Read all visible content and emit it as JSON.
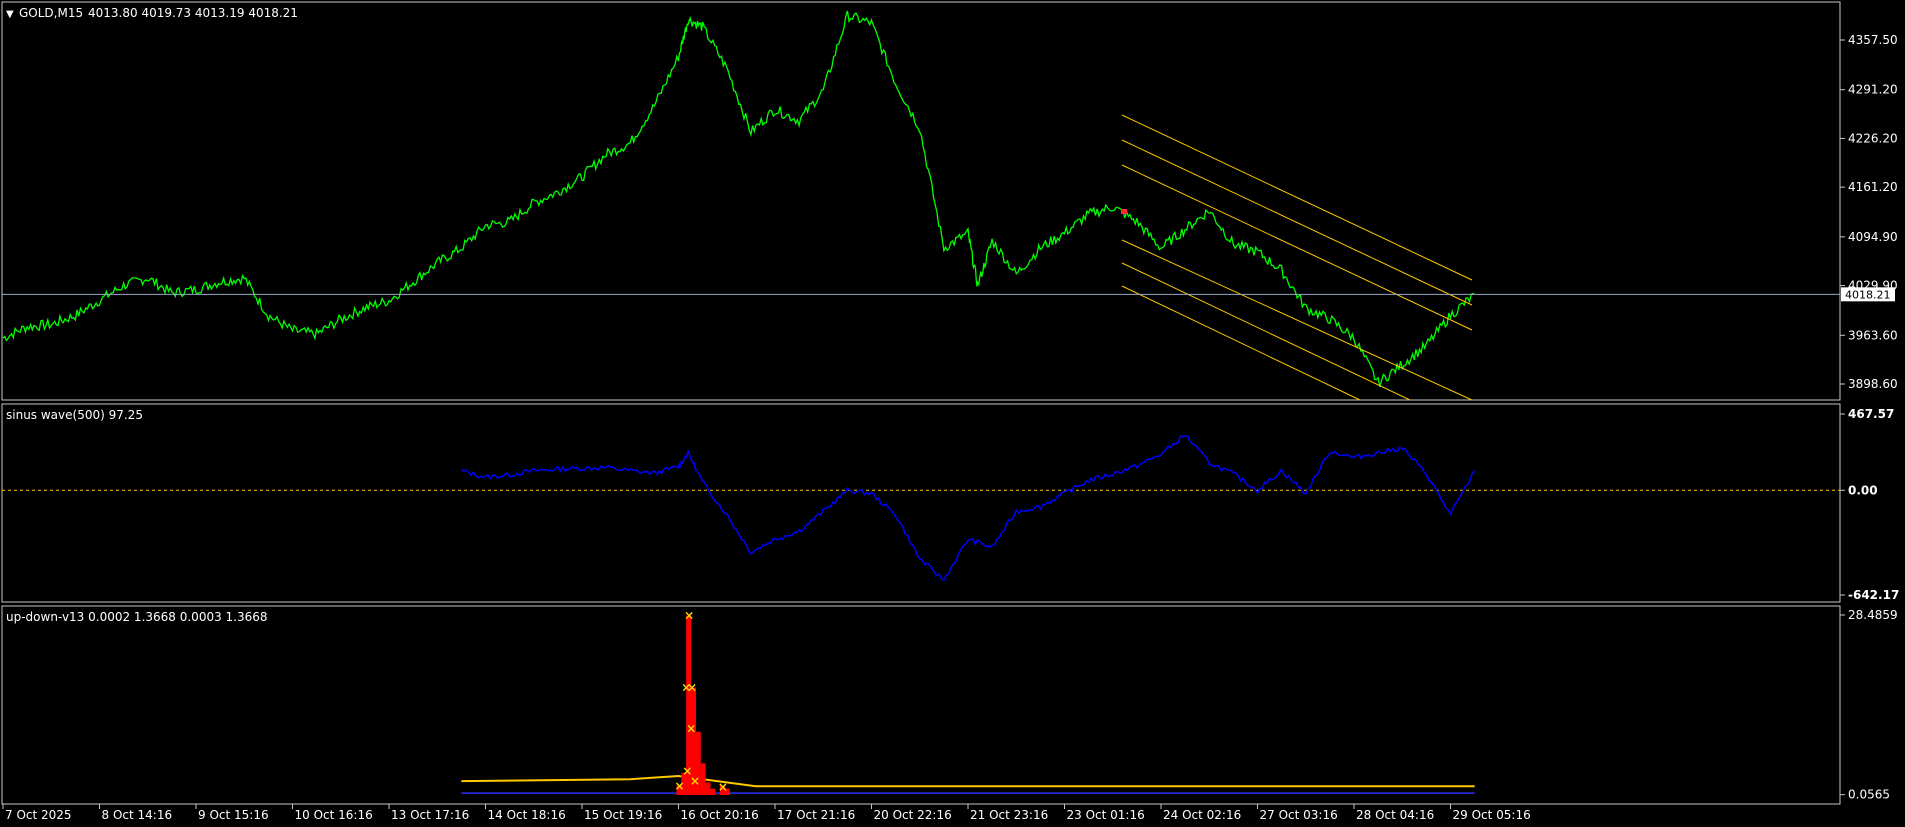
{
  "header": {
    "symbol_label": "GOLD,M15",
    "ohlc": "4013.80 4019.73 4013.19 4018.21"
  },
  "colors": {
    "background": "#000000",
    "frame": "#c8c8c8",
    "price_line": "#00ff00",
    "channel": "#ffc800",
    "sinus": "#0000ff",
    "histogram": "#ff0000",
    "marker": "#ffd700",
    "current_price_line": "#9aa8c8"
  },
  "chart_data": [
    {
      "type": "line",
      "panel": "main",
      "series_label": "GOLD,M15",
      "current_price": 4018.21,
      "current_price_label": "4018.21",
      "yticks": [
        "4357.50",
        "4291.20",
        "4226.20",
        "4161.20",
        "4094.90",
        "4029.90",
        "3963.60",
        "3898.60"
      ],
      "ylim": [
        3880,
        4410
      ],
      "x_dates": [
        "7 Oct 2025",
        "8 Oct 14:16",
        "9 Oct 15:16",
        "10 Oct 16:16",
        "13 Oct 17:16",
        "14 Oct 18:16",
        "15 Oct 19:16",
        "16 Oct 20:16",
        "17 Oct 21:16",
        "20 Oct 22:16",
        "21 Oct 23:16",
        "23 Oct 01:16",
        "24 Oct 02:16",
        "27 Oct 03:16",
        "28 Oct 04:16",
        "29 Oct 05:16"
      ],
      "x": [
        0,
        0.25,
        0.5,
        0.75,
        1,
        1.25,
        1.5,
        1.75,
        2,
        2.25,
        2.5,
        2.75,
        3,
        3.25,
        3.5,
        3.75,
        4,
        4.25,
        4.5,
        4.75,
        5,
        5.25,
        5.5,
        5.75,
        6,
        6.25,
        6.5,
        6.75,
        7,
        7.1,
        7.25,
        7.5,
        7.75,
        8,
        8.25,
        8.5,
        8.75,
        9,
        9.25,
        9.5,
        9.75,
        10,
        10.1,
        10.25,
        10.5,
        10.75,
        11,
        11.25,
        11.5,
        11.75,
        12,
        12.25,
        12.5,
        12.75,
        13,
        13.25,
        13.5,
        13.75,
        14,
        14.25,
        14.5,
        14.75,
        15,
        15.25
      ],
      "values": [
        3960,
        3975,
        3978,
        3990,
        4010,
        4030,
        4040,
        4020,
        4025,
        4035,
        4040,
        3990,
        3970,
        3965,
        3985,
        4000,
        4010,
        4035,
        4060,
        4080,
        4110,
        4115,
        4140,
        4155,
        4175,
        4205,
        4220,
        4270,
        4335,
        4385,
        4375,
        4320,
        4235,
        4265,
        4250,
        4290,
        4390,
        4380,
        4300,
        4240,
        4080,
        4100,
        4030,
        4090,
        4045,
        4080,
        4100,
        4125,
        4135,
        4115,
        4080,
        4105,
        4130,
        4085,
        4075,
        4050,
        4000,
        3985,
        3960,
        3900,
        3925,
        3950,
        3990,
        4018
      ]
    },
    {
      "type": "line",
      "panel": "indicator",
      "series_label": "sinus wave(500) 97.25",
      "yticks": [
        "467.57",
        "0.00",
        "-642.17"
      ],
      "ylim": [
        -642.17,
        467.57
      ],
      "x": [
        4.75,
        5,
        5.25,
        5.5,
        5.75,
        6,
        6.25,
        6.5,
        6.75,
        7,
        7.1,
        7.25,
        7.5,
        7.75,
        8,
        8.25,
        8.5,
        8.75,
        9,
        9.25,
        9.5,
        9.75,
        10,
        10.25,
        10.5,
        10.75,
        11,
        11.25,
        11.5,
        11.75,
        12,
        12.25,
        12.5,
        12.75,
        13,
        13.25,
        13.5,
        13.75,
        14,
        14.25,
        14.5,
        14.75,
        15,
        15.25
      ],
      "values": [
        120,
        80,
        95,
        120,
        130,
        135,
        140,
        120,
        105,
        145,
        230,
        50,
        -150,
        -380,
        -300,
        -250,
        -130,
        0,
        -20,
        -150,
        -420,
        -550,
        -300,
        -350,
        -130,
        -100,
        -20,
        60,
        100,
        150,
        220,
        340,
        170,
        100,
        0,
        120,
        -20,
        240,
        200,
        230,
        260,
        100,
        -150,
        120
      ]
    },
    {
      "type": "bar",
      "panel": "indicator",
      "series_label": "up-down-v13 0.0002 1.3668 0.0003 1.3668",
      "yticks": [
        "28.4859",
        "0.0565"
      ],
      "ylim": [
        0,
        28.4859
      ],
      "bars": [
        {
          "x": 7.0,
          "value": 1.5
        },
        {
          "x": 7.05,
          "value": 3.5
        },
        {
          "x": 7.1,
          "value": 28.4
        },
        {
          "x": 7.15,
          "value": 17
        },
        {
          "x": 7.2,
          "value": 10
        },
        {
          "x": 7.25,
          "value": 5
        },
        {
          "x": 7.3,
          "value": 2
        },
        {
          "x": 7.35,
          "value": 1
        },
        {
          "x": 7.45,
          "value": 1.5
        },
        {
          "x": 7.5,
          "value": 1
        }
      ],
      "markers": [
        28.4,
        17,
        17,
        10.5,
        3.8,
        2.2,
        1.4,
        1.3
      ],
      "yellow_line": [
        {
          "x": 4.75,
          "value": 2.2
        },
        {
          "x": 6.5,
          "value": 2.5
        },
        {
          "x": 7.0,
          "value": 3.0
        },
        {
          "x": 7.8,
          "value": 1.4
        },
        {
          "x": 15.25,
          "value": 1.4
        }
      ]
    }
  ]
}
